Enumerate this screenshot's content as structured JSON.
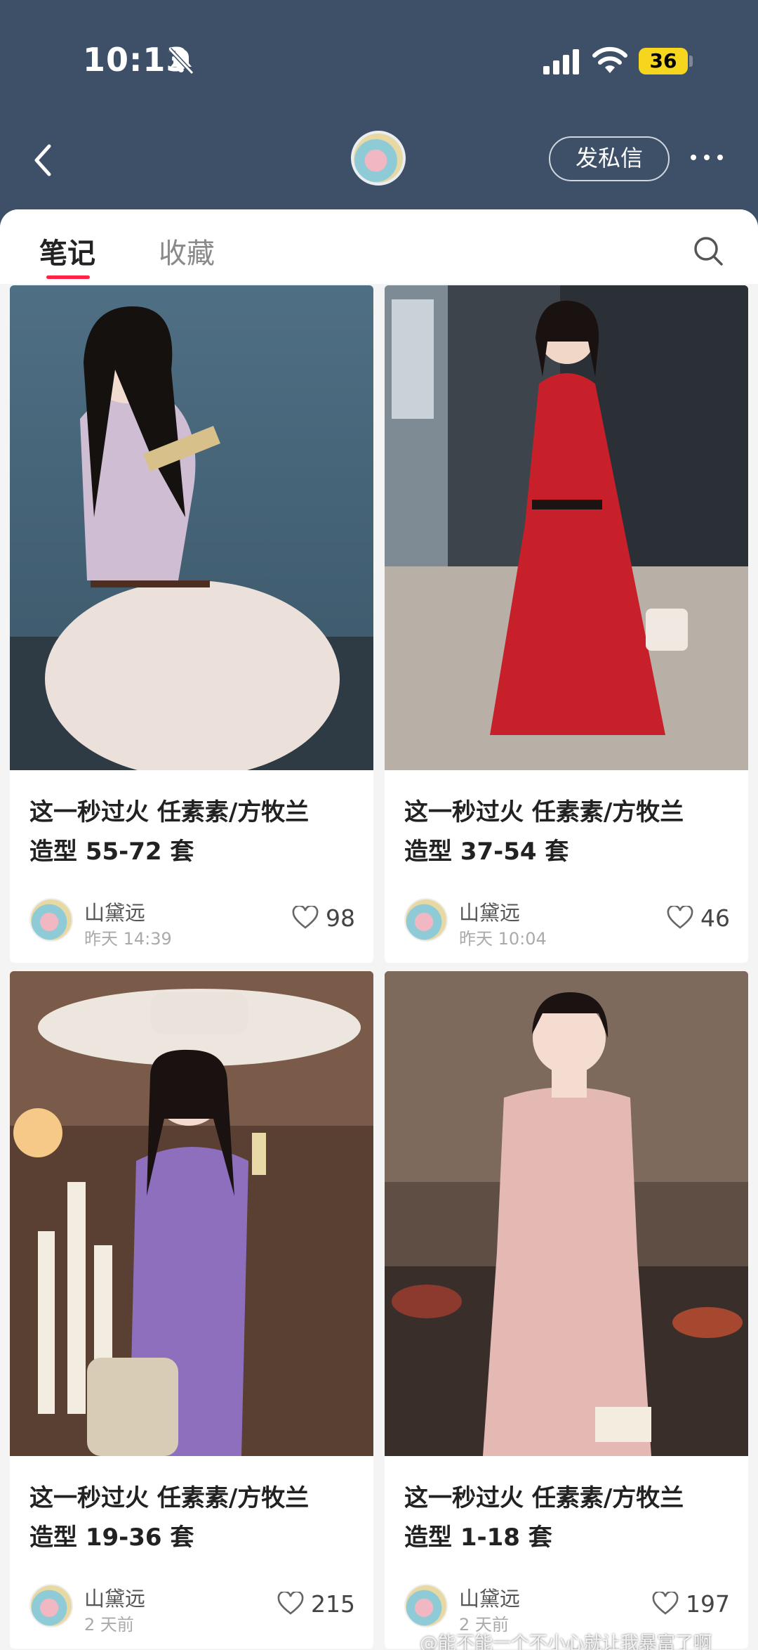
{
  "status_bar": {
    "time": "10:13",
    "battery": "36",
    "icons": [
      "bell-off-icon",
      "signal-icon",
      "wifi-icon",
      "battery-icon"
    ]
  },
  "nav": {
    "back_icon": "chevron-left-icon",
    "dm_label": "发私信",
    "more_icon": "more-dots-icon"
  },
  "tabs": {
    "notes_label": "笔记",
    "collect_label": "收藏",
    "search_icon": "search-icon"
  },
  "cards": [
    {
      "title_line1": "这一秒过火 任素素/方牧兰",
      "title_line2": "造型 55-72 套",
      "author": "山黛远",
      "time": "昨天 14:39",
      "likes": "98"
    },
    {
      "title_line1": "这一秒过火 任素素/方牧兰",
      "title_line2": "造型 37-54 套",
      "author": "山黛远",
      "time": "昨天 10:04",
      "likes": "46"
    },
    {
      "title_line1": "这一秒过火 任素素/方牧兰",
      "title_line2": "造型 19-36 套",
      "author": "山黛远",
      "time": "2 天前",
      "likes": "215"
    },
    {
      "title_line1": "这一秒过火 任素素/方牧兰",
      "title_line2": "造型 1-18 套",
      "author": "山黛远",
      "time": "2 天前",
      "likes": "197"
    }
  ],
  "watermark": "@能不能一个不小心就让我暴富了啊",
  "colors": {
    "header_bg": "#3d5068",
    "accent": "#ff2442",
    "battery": "#f5d51e"
  }
}
